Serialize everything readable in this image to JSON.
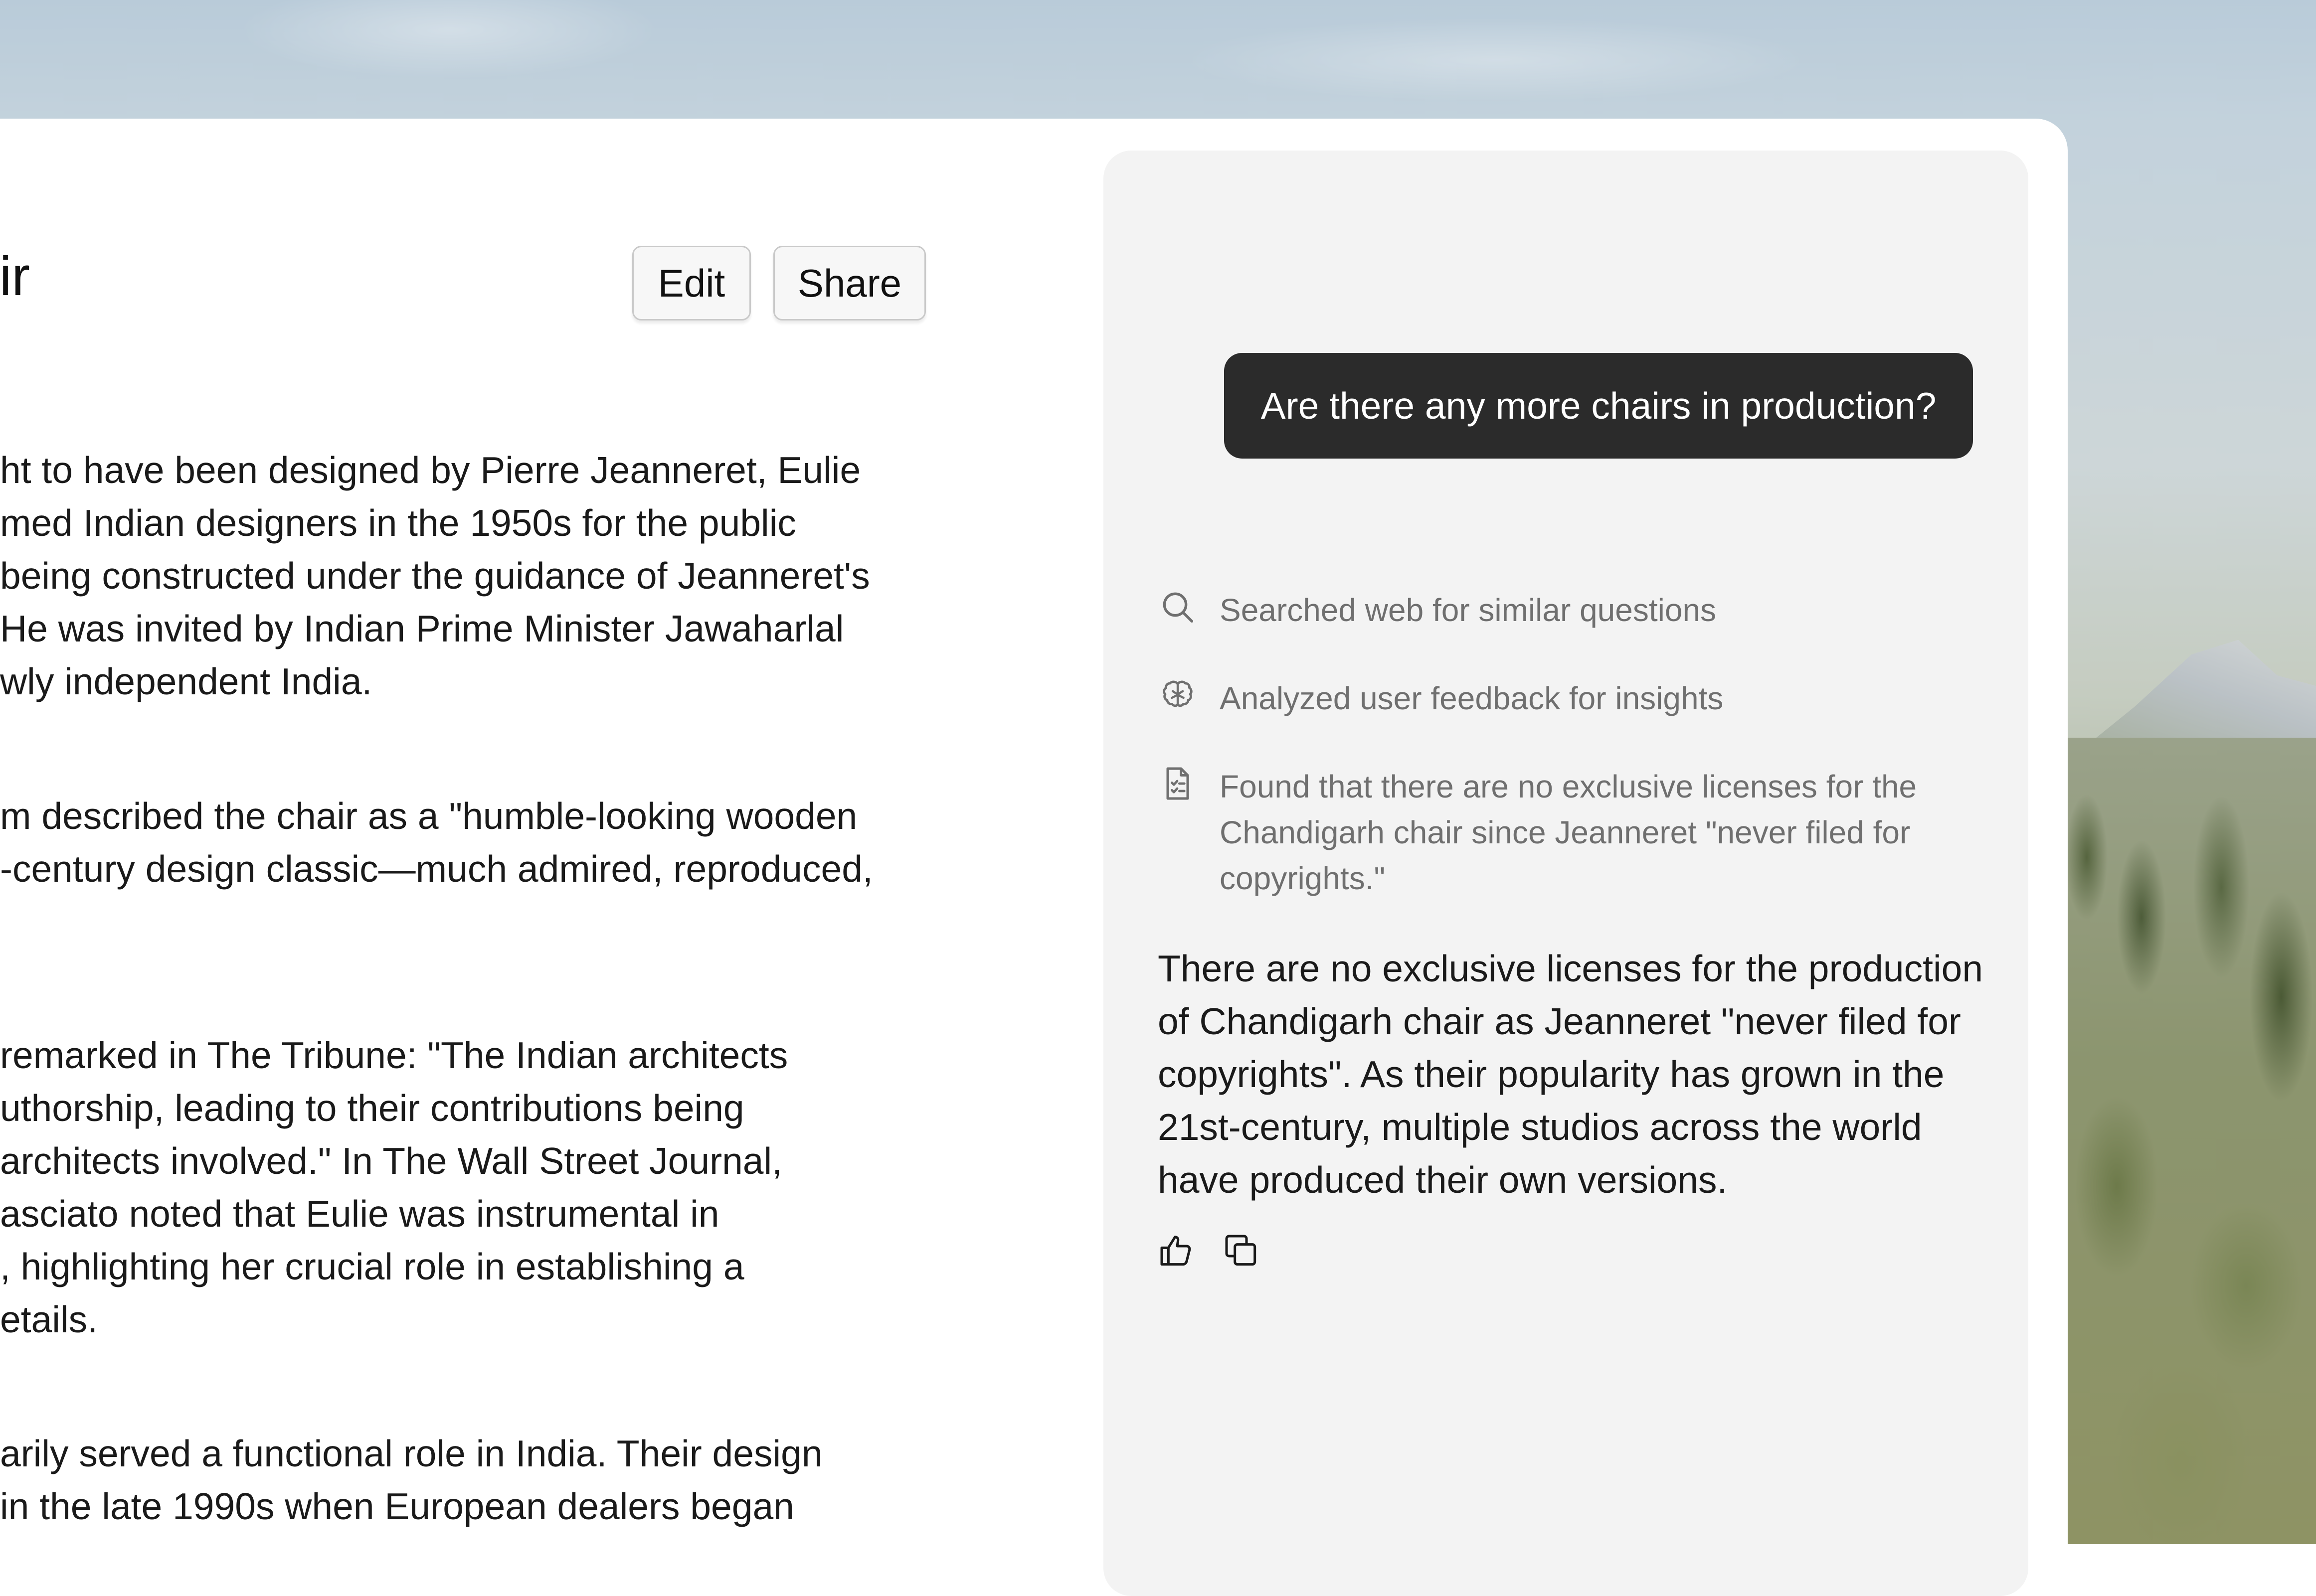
{
  "document": {
    "title_fragment": "ir",
    "toolbar": {
      "edit_label": "Edit",
      "share_label": "Share"
    },
    "paragraphs": [
      {
        "lines": [
          "ht to have been designed by Pierre Jeanneret, Eulie",
          "med Indian designers in the 1950s for the public",
          "being constructed under the guidance of Jeanneret's",
          " He was invited by Indian Prime Minister Jawaharlal",
          "wly independent India."
        ]
      },
      {
        "lines": [
          "m described the chair as a \"humble-looking wooden",
          "-century design classic—much admired, reproduced,"
        ]
      },
      {
        "lines": [
          " remarked in The Tribune: \"The Indian architects",
          "uthorship, leading to their contributions being",
          " architects involved.\" In The Wall Street Journal,",
          "asciato noted that Eulie was instrumental in",
          ", highlighting her crucial role in establishing a",
          "etails."
        ]
      },
      {
        "lines": [
          "arily served a functional role in India. Their design",
          " in the late 1990s when European dealers began"
        ]
      }
    ]
  },
  "chat": {
    "user_message": "Are there any more chairs in production?",
    "steps": [
      {
        "icon": "search-icon",
        "lines": [
          "Searched web for similar questions"
        ]
      },
      {
        "icon": "brain-icon",
        "lines": [
          "Analyzed user feedback for insights"
        ]
      },
      {
        "icon": "document-checklist-icon",
        "lines": [
          "Found that there are no exclusive licenses for the",
          "Chandigarh chair since Jeanneret \"never filed for",
          "copyrights.\""
        ]
      }
    ],
    "answer_lines": [
      "There are no exclusive licenses for the production",
      "of Chandigarh chair as Jeanneret \"never filed for",
      "copyrights\". As their popularity has grown in the",
      "21st-century, multiple studios across the world",
      "have produced their own versions."
    ],
    "actions": [
      {
        "icon": "thumbs-up-icon"
      },
      {
        "icon": "copy-icon"
      }
    ]
  },
  "colors": {
    "user_bubble": "#2b2b2b",
    "chat_panel": "#f3f3f3",
    "muted_text": "#6f6f6f"
  }
}
